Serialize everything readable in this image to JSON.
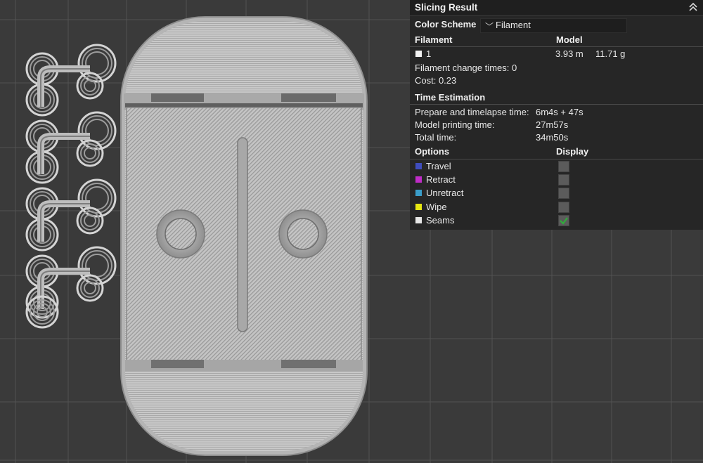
{
  "panel": {
    "title": "Slicing Result",
    "color_scheme_label": "Color Scheme",
    "color_scheme_value": "Filament",
    "filament_header": "Filament",
    "model_header": "Model",
    "filament_row": {
      "id": "1",
      "length": "3.93 m",
      "weight": "11.71 g"
    },
    "filament_change": "Filament change times:  0",
    "cost": "Cost:  0.23",
    "time_header": "Time Estimation",
    "time_rows": [
      {
        "label": "Prepare and timelapse time:",
        "value": "6m4s + 47s"
      },
      {
        "label": "Model printing time:",
        "value": "27m57s"
      },
      {
        "label": "Total time:",
        "value": "34m50s"
      }
    ],
    "options_header": "Options",
    "display_header": "Display",
    "options": [
      {
        "label": "Travel",
        "color": "#3f4dbd",
        "checked": false
      },
      {
        "label": "Retract",
        "color": "#c02cc8",
        "checked": false
      },
      {
        "label": "Unretract",
        "color": "#3a9dc9",
        "checked": false
      },
      {
        "label": "Wipe",
        "color": "#e8e812",
        "checked": false
      },
      {
        "label": "Seams",
        "color": "#e6e6e6",
        "checked": true
      }
    ]
  },
  "colors": {
    "background": "#3a3a3a",
    "grid": "#525252",
    "model": "#bdbdbd",
    "panel_bg": "#262626",
    "check_mark": "#2fae3a"
  }
}
